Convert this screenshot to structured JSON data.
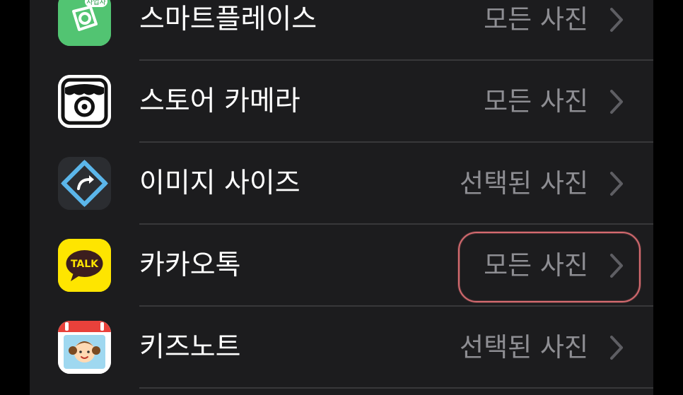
{
  "colors": {
    "background": "#000000",
    "panel": "#1c1c1e",
    "primary_text": "#ffffff",
    "secondary_text": "#8e8e93",
    "separator": "#38383a",
    "highlight": "#d46a6f"
  },
  "apps": [
    {
      "name": "스마트플레이스",
      "access": "모든 사진",
      "icon": "smartplace-app-icon",
      "icon_badge": "사업자"
    },
    {
      "name": "스토어 카메라",
      "access": "모든 사진",
      "icon": "store-camera-app-icon"
    },
    {
      "name": "이미지 사이즈",
      "access": "선택된 사진",
      "icon": "image-size-app-icon"
    },
    {
      "name": "카카오톡",
      "access": "모든 사진",
      "icon": "kakaotalk-app-icon",
      "icon_badge": "TALK",
      "highlighted": true
    },
    {
      "name": "키즈노트",
      "access": "선택된 사진",
      "icon": "kidsnote-app-icon"
    }
  ]
}
